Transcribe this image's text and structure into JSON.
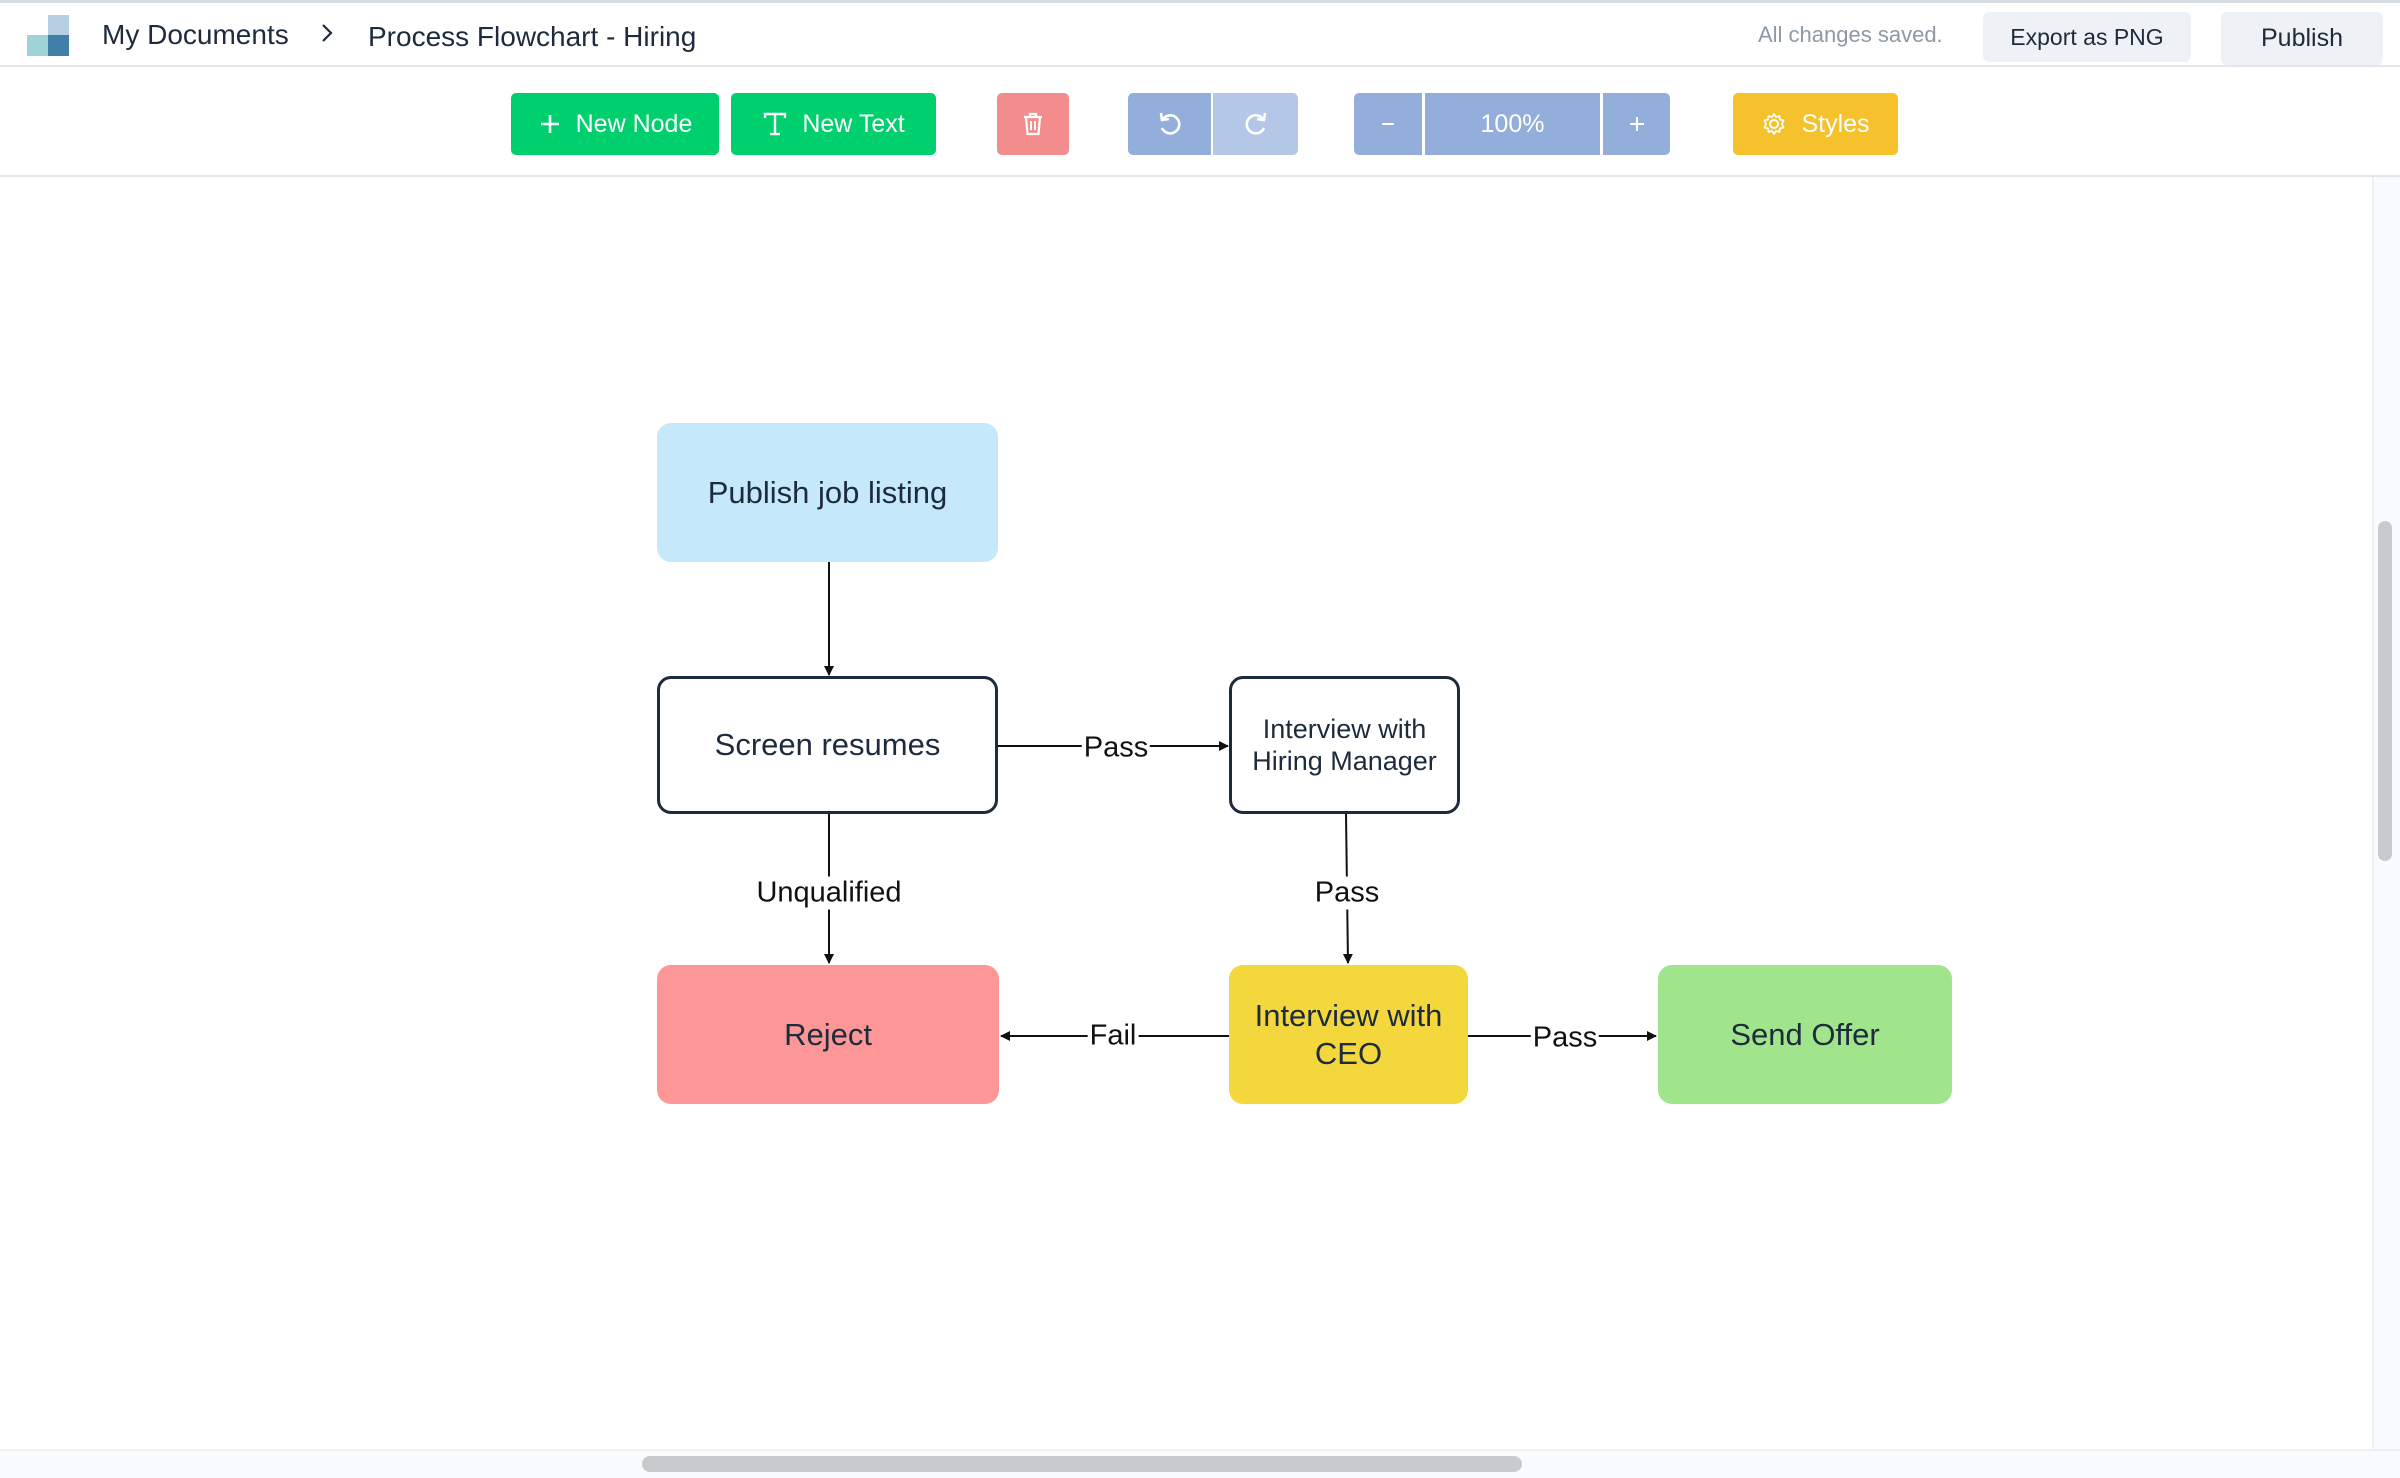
{
  "header": {
    "breadcrumb_root": "My Documents",
    "document_title": "Process Flowchart - Hiring",
    "save_status": "All changes saved.",
    "export_label": "Export as PNG",
    "publish_label": "Publish"
  },
  "toolbar": {
    "new_node_label": "New Node",
    "new_text_label": "New Text",
    "zoom_level": "100%",
    "styles_label": "Styles"
  },
  "flowchart": {
    "nodes": {
      "publish": "Publish job listing",
      "screen": "Screen resumes",
      "interview_hm": "Interview with Hiring Manager",
      "reject": "Reject",
      "interview_ceo": "Interview with CEO",
      "offer": "Send Offer"
    },
    "edges": {
      "screen_to_hm": "Pass",
      "screen_to_reject": "Unqualified",
      "hm_to_ceo": "Pass",
      "ceo_to_reject": "Fail",
      "ceo_to_offer": "Pass"
    }
  },
  "colors": {
    "accent_green": "#00cf6e",
    "delete_red": "#f38c8c",
    "control_blue": "#93aedb",
    "styles_yellow": "#f5c22d",
    "node_blue": "#c5e8fb",
    "node_red": "#fd9797",
    "node_yellow": "#f4d73c",
    "node_green": "#a0e48c",
    "node_border": "#1d2b3c"
  }
}
